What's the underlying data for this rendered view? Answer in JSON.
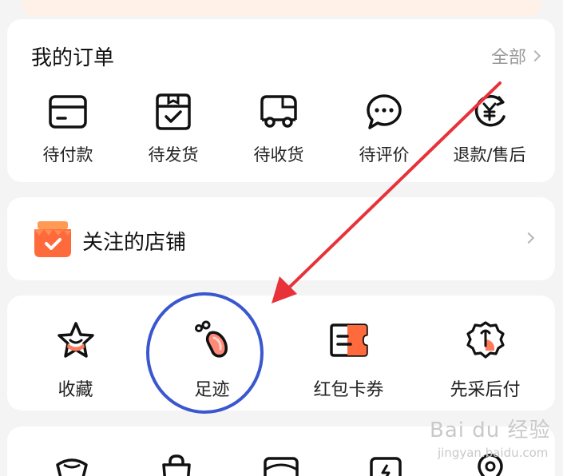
{
  "orders": {
    "title": "我的订单",
    "all_label": "全部",
    "items": [
      {
        "label": "待付款",
        "icon": "wallet-card-icon"
      },
      {
        "label": "待发货",
        "icon": "package-box-icon"
      },
      {
        "label": "待收货",
        "icon": "delivery-truck-icon"
      },
      {
        "label": "待评价",
        "icon": "chat-bubble-icon"
      },
      {
        "label": "退款/售后",
        "icon": "refund-yen-icon"
      }
    ]
  },
  "shops": {
    "title": "关注的店铺",
    "icon": "shop-bag-icon"
  },
  "tools": {
    "items": [
      {
        "label": "收藏",
        "icon": "star-icon"
      },
      {
        "label": "足迹",
        "icon": "footprint-icon"
      },
      {
        "label": "红包卡券",
        "icon": "ticket-icon"
      },
      {
        "label": "先采后付",
        "icon": "pay-later-icon"
      }
    ]
  },
  "watermark": {
    "main": "Bai du 经验",
    "sub": "jingyan.baidu.com"
  },
  "colors": {
    "accent_orange": "#ff6a3d",
    "accent_pink": "#ff8a80",
    "annotation_red": "#e8323a",
    "annotation_blue": "#3a57cf"
  }
}
